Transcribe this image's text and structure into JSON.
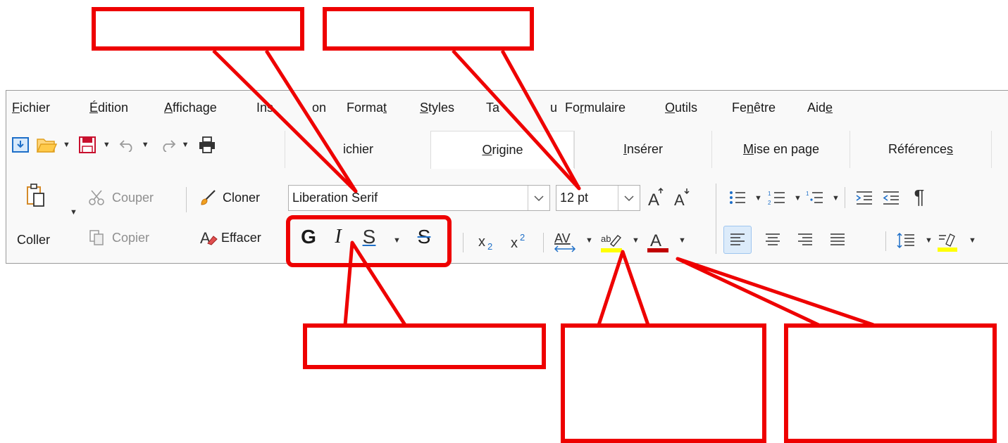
{
  "menu": {
    "items": [
      {
        "pre": "",
        "u": "F",
        "post": "ichier"
      },
      {
        "pre": "",
        "u": "É",
        "post": "dition"
      },
      {
        "pre": "",
        "u": "A",
        "post": "ffichage"
      },
      {
        "pre": "Ins",
        "u": "",
        "post": ""
      },
      {
        "pre": "",
        "u": "",
        "post": "on"
      },
      {
        "pre": "Forma",
        "u": "t",
        "post": ""
      },
      {
        "pre": "",
        "u": "S",
        "post": "tyles"
      },
      {
        "pre": "Ta",
        "u": "",
        "post": ""
      },
      {
        "pre": "",
        "u": "",
        "post": "u"
      },
      {
        "pre": "Fo",
        "u": "r",
        "post": "mulaire"
      },
      {
        "pre": "",
        "u": "O",
        "post": "utils"
      },
      {
        "pre": "Fe",
        "u": "n",
        "post": "être"
      },
      {
        "pre": "Aid",
        "u": "e",
        "post": ""
      }
    ]
  },
  "tabs": [
    {
      "label": "ichier",
      "u_pre": "",
      "u": "",
      "u_post": "ichier"
    },
    {
      "label": "Origine",
      "u_pre": "",
      "u": "O",
      "u_post": "rigine"
    },
    {
      "label": "Insérer",
      "u_pre": "",
      "u": "I",
      "u_post": "nsérer"
    },
    {
      "label": "Mise en page",
      "u_pre": "",
      "u": "M",
      "u_post": "ise en page"
    },
    {
      "label": "Références",
      "u_pre": "Référence",
      "u": "s",
      "u_post": ""
    }
  ],
  "ribbon": {
    "paste_label": "Coller",
    "cut_label": "Couper",
    "copy_label": "Copier",
    "clone_label": "Cloner",
    "clear_label": "Effacer",
    "font_name": "Liberation Serif",
    "font_size": "12 pt",
    "bold": "G",
    "italic": "I",
    "underline": "S",
    "strike": "S"
  },
  "colors": {
    "callout": "#ee0000",
    "highlight": "#ffff00",
    "font_color": "#c00000",
    "accent": "#1e6fc8"
  }
}
